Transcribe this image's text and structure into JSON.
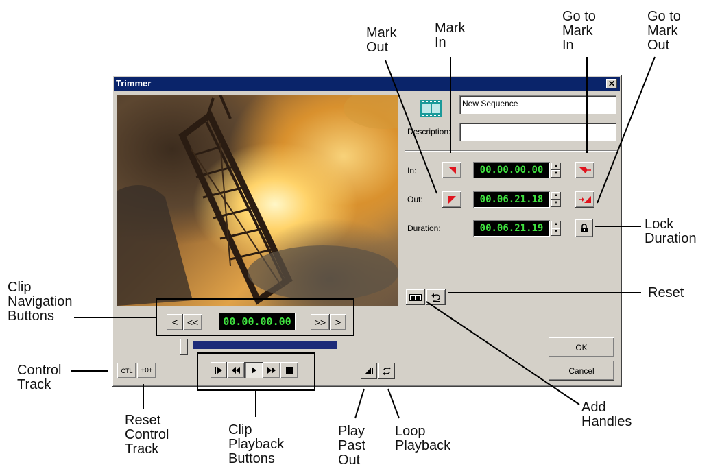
{
  "window": {
    "title": "Trimmer",
    "close_label": "✕",
    "sequence_name": "New Sequence",
    "description_label": "Description:",
    "description_value": "",
    "in_label": "In:",
    "out_label": "Out:",
    "duration_label": "Duration:",
    "in_timecode": "00.00.00.00",
    "out_timecode": "00.06.21.18",
    "duration_timecode": "00.06.21.19",
    "position_timecode": "00.00.00.00",
    "ok_label": "OK",
    "cancel_label": "Cancel",
    "ctl_label": "CTL",
    "reset_ctl_label": "+0+",
    "nav_prev_label": "<",
    "nav_first_label": "<<",
    "nav_last_label": ">>",
    "nav_next_label": ">"
  },
  "callouts": {
    "mark_out": "Mark\nOut",
    "mark_in": "Mark\nIn",
    "go_to_mark_in": "Go to\nMark\nIn",
    "go_to_mark_out": "Go to\nMark\nOut",
    "lock_duration": "Lock\nDuration",
    "reset": "Reset",
    "clip_navigation_buttons": "Clip\nNavigation\nButtons",
    "control_track": "Control\nTrack",
    "reset_control_track": "Reset\nControl\nTrack",
    "clip_playback_buttons": "Clip\nPlayback\nButtons",
    "play_past_out": "Play\nPast\nOut",
    "loop_playback": "Loop\nPlayback",
    "add_handles": "Add\nHandles"
  },
  "icons": {
    "sequence": "film-strip-icon",
    "mark_in": "mark-in-icon",
    "mark_out": "mark-out-icon",
    "go_to_mark_in": "go-to-mark-in-icon",
    "go_to_mark_out": "go-to-mark-out-icon",
    "lock": "padlock-icon",
    "add_handles": "add-handles-icon",
    "reset": "undo-arrow-icon",
    "play_past_out": "play-past-out-icon",
    "loop": "loop-icon"
  },
  "colors": {
    "title_bar": "#0a246a",
    "timecode_text": "#3fe23f",
    "mark_red": "#e0141e",
    "scrub_bar": "#1c2a78"
  },
  "scrub_position": 0.0
}
